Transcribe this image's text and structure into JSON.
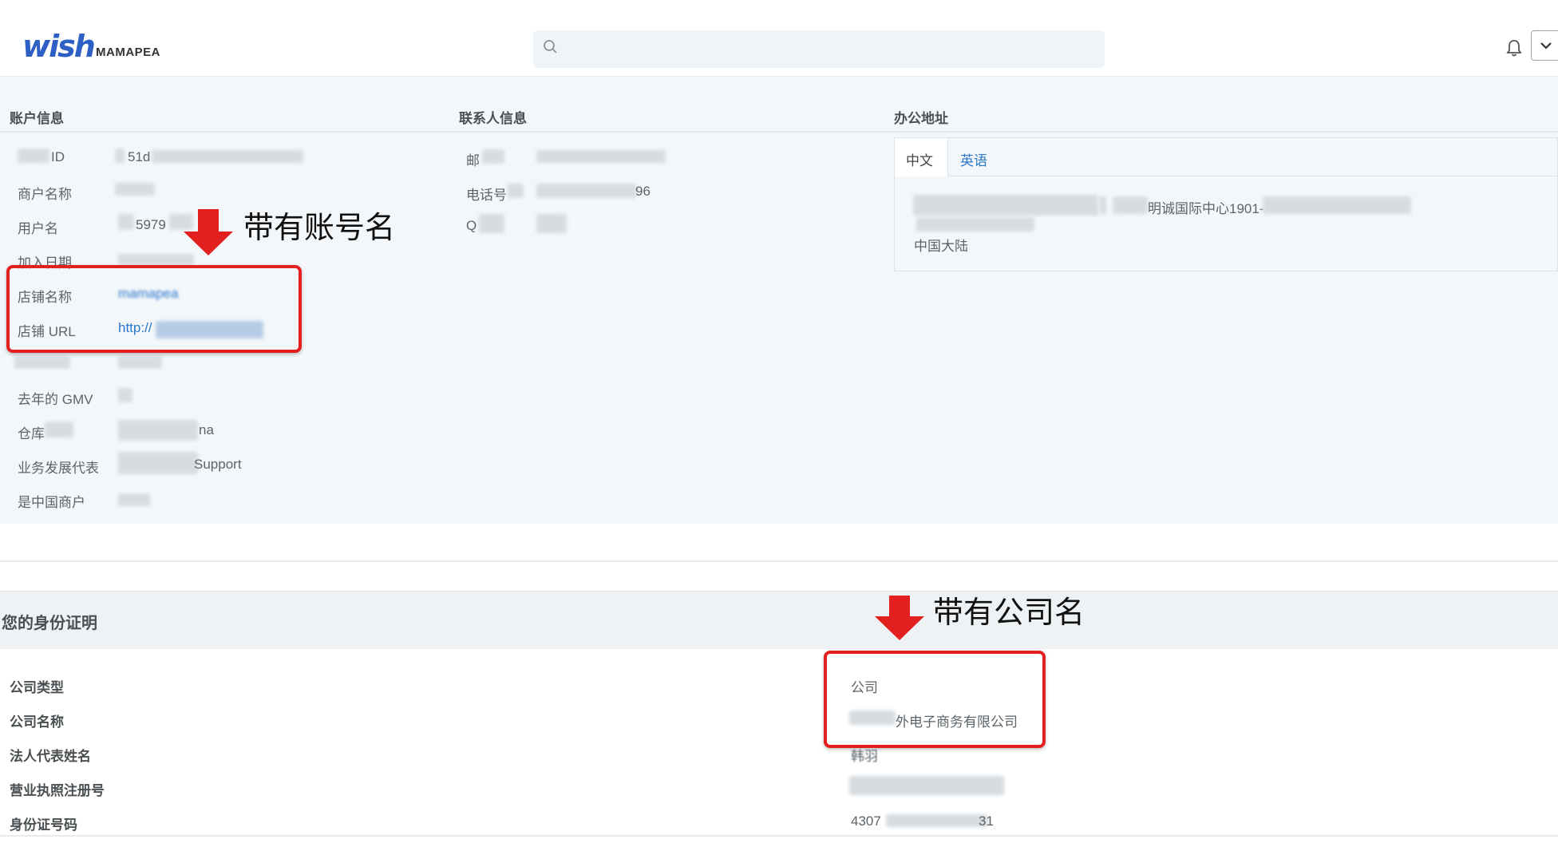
{
  "header": {
    "logo_text": "wish",
    "merchant_name": "MAMAPEA",
    "search_placeholder": "",
    "brand_color": "#2d5fc4"
  },
  "account_info": {
    "title": "账户信息",
    "rows": [
      {
        "label": "ID",
        "value": "51d"
      },
      {
        "label": "商户名称",
        "value": ""
      },
      {
        "label": "用户名",
        "value": "5979"
      },
      {
        "label": "加入日期",
        "value": ""
      },
      {
        "label": "店铺名称",
        "value": "mamapea"
      },
      {
        "label": "店铺 URL",
        "value": "http://"
      },
      {
        "label": "",
        "value": ""
      },
      {
        "label": "去年的 GMV",
        "value": ""
      },
      {
        "label": "仓库",
        "value": "na"
      },
      {
        "label": "业务发展代表",
        "value": "Support"
      },
      {
        "label": "是中国商户",
        "value": ""
      }
    ]
  },
  "contact_info": {
    "title": "联系人信息",
    "rows": [
      {
        "label": "邮",
        "value": ""
      },
      {
        "label": "电话号",
        "value": "96"
      },
      {
        "label": "Q",
        "value": ""
      }
    ]
  },
  "office_address": {
    "title": "办公地址",
    "tabs": [
      "中文",
      "英语"
    ],
    "active_tab": "中文",
    "address_line": "明诚国际中心1901-",
    "country": "中国大陆"
  },
  "annotations": {
    "account_note": "带有账号名",
    "company_note": "带有公司名",
    "highlight_color": "#e32020"
  },
  "identity": {
    "title": "您的身份证明",
    "rows": [
      {
        "label": "公司类型",
        "value": "公司"
      },
      {
        "label": "公司名称",
        "value": "外电子商务有限公司"
      },
      {
        "label": "法人代表姓名",
        "value": "韩羽"
      },
      {
        "label": "营业执照注册号",
        "value": ""
      },
      {
        "label": "身份证号码",
        "value": "4307"
      }
    ],
    "id_suffix": "31"
  }
}
